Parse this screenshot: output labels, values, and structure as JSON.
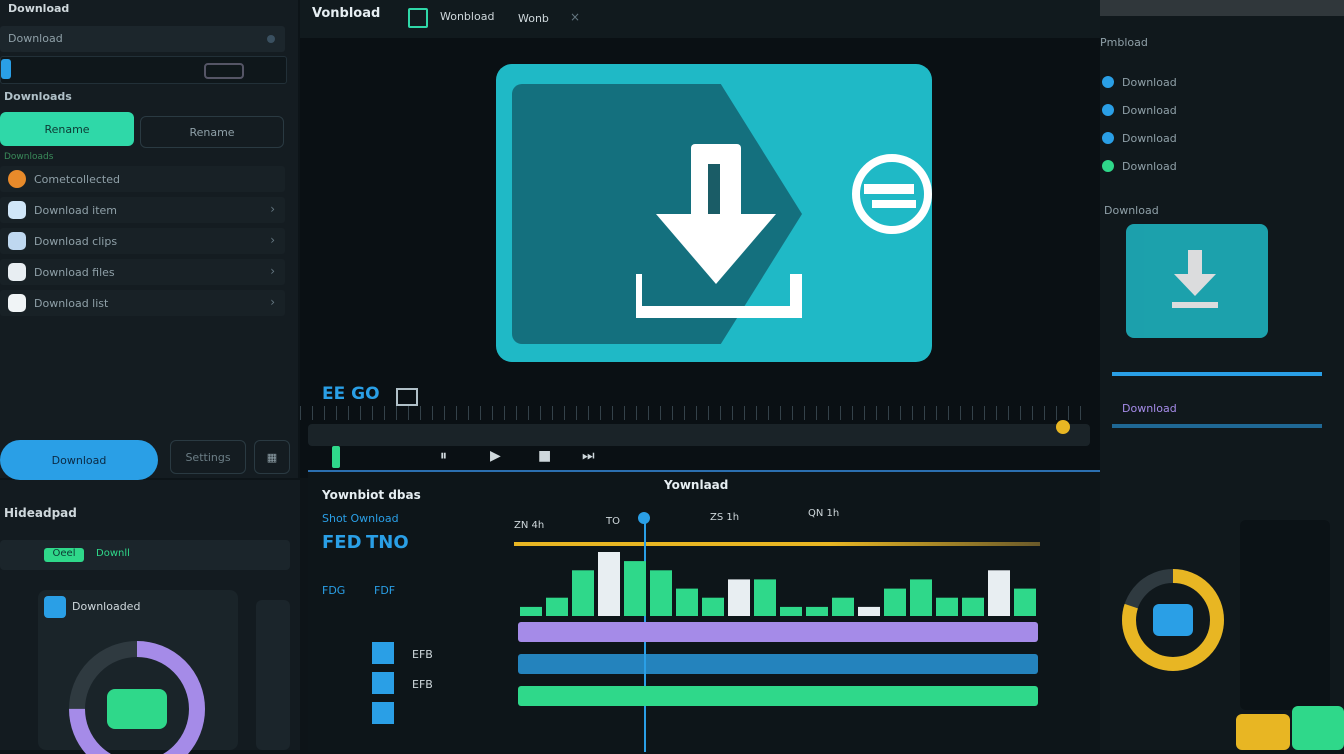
{
  "colors": {
    "accent": "#1fb9c6",
    "green": "#2fd88a",
    "blue": "#2a9fe6",
    "purple": "#a58be8",
    "yellow": "#e8b623",
    "orange": "#e88a2a"
  },
  "toolbar": {
    "title": "Vonbload",
    "tab1": "Wonbload",
    "tab2": "Wonb"
  },
  "left": {
    "header_label": "Download",
    "segment": {
      "left": "Rename",
      "right": "Rename"
    },
    "section_label": "Downloads",
    "items": [
      "Cometcollected",
      "Download item",
      "Download clips",
      "Download files",
      "Download list"
    ],
    "primary_button": "Download",
    "secondary_button": "Settings"
  },
  "preview": {
    "icon": "download-arrow-icon",
    "transport_label": "EE GO"
  },
  "timeline": {
    "panel_title": "Yownlaad",
    "section_title": "Yownbiot dbas",
    "sub_title": "Shot Ownload",
    "tool_labels": [
      "FED",
      "TNO"
    ],
    "time_labels": [
      "ZN 4h",
      "TO",
      "ZS 1h",
      "QN 1h"
    ],
    "track_names": [
      "FDG",
      "FDF",
      "EFB",
      "EFB"
    ]
  },
  "bottom_left": {
    "header": "Hideadpad",
    "tab1": "Oeel",
    "tab2": "Downll",
    "card_title": "Downloaded",
    "gauge_value": 0.75
  },
  "right": {
    "title": "Pmbload",
    "items": [
      "Download",
      "Download",
      "Download",
      "Download"
    ],
    "section": "Download",
    "item_b": "Download",
    "gauge_value": 0.8
  },
  "chart_data": {
    "type": "bar",
    "values": [
      1,
      2,
      5,
      7,
      6,
      5,
      3,
      2,
      4,
      4,
      1,
      1,
      2,
      1,
      3,
      4,
      2,
      2,
      5,
      3
    ]
  }
}
